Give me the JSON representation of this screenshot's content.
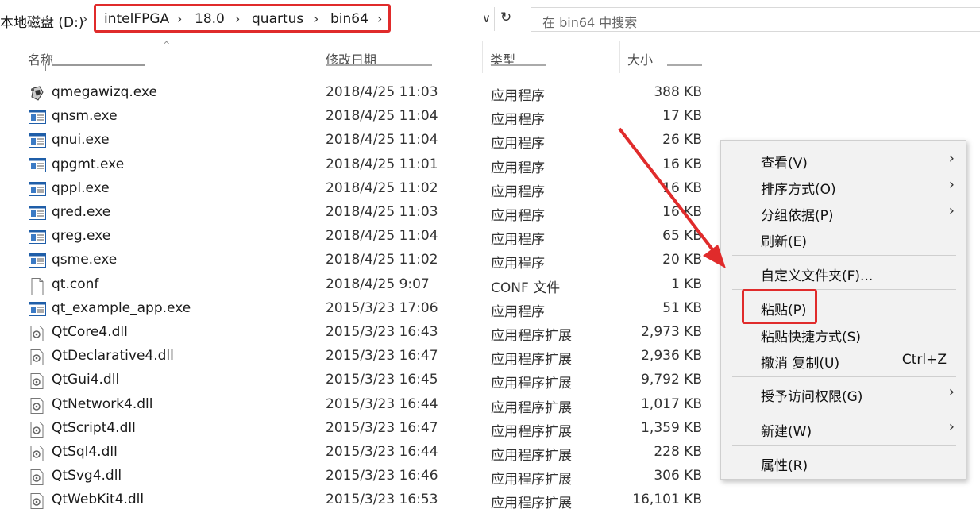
{
  "address": {
    "root": "本地磁盘 (D:)",
    "path": [
      "intelFPGA",
      "18.0",
      "quartus",
      "bin64"
    ],
    "sep": "›",
    "dropdown": "∨",
    "refresh": "↻"
  },
  "search": {
    "placeholder": "在 bin64 中搜索"
  },
  "columns": {
    "name": "名称",
    "date": "修改日期",
    "type": "类型",
    "size": "大小"
  },
  "files": [
    {
      "name": "qmegawizq.exe",
      "date": "2018/4/25 11:03",
      "type": "应用程序",
      "size": "388 KB",
      "icon": "app-wizard-icon"
    },
    {
      "name": "qnsm.exe",
      "date": "2018/4/25 11:04",
      "type": "应用程序",
      "size": "17 KB",
      "icon": "exe-window-icon"
    },
    {
      "name": "qnui.exe",
      "date": "2018/4/25 11:04",
      "type": "应用程序",
      "size": "26 KB",
      "icon": "exe-window-icon"
    },
    {
      "name": "qpgmt.exe",
      "date": "2018/4/25 11:01",
      "type": "应用程序",
      "size": "16 KB",
      "icon": "exe-window-icon"
    },
    {
      "name": "qppl.exe",
      "date": "2018/4/25 11:02",
      "type": "应用程序",
      "size": "16 KB",
      "icon": "exe-window-icon"
    },
    {
      "name": "qred.exe",
      "date": "2018/4/25 11:03",
      "type": "应用程序",
      "size": "16 KB",
      "icon": "exe-window-icon"
    },
    {
      "name": "qreg.exe",
      "date": "2018/4/25 11:04",
      "type": "应用程序",
      "size": "65 KB",
      "icon": "exe-window-icon"
    },
    {
      "name": "qsme.exe",
      "date": "2018/4/25 11:02",
      "type": "应用程序",
      "size": "20 KB",
      "icon": "exe-window-icon"
    },
    {
      "name": "qt.conf",
      "date": "2018/4/25 9:07",
      "type": "CONF 文件",
      "size": "1 KB",
      "icon": "blank-file-icon"
    },
    {
      "name": "qt_example_app.exe",
      "date": "2015/3/23 17:06",
      "type": "应用程序",
      "size": "51 KB",
      "icon": "exe-window-icon"
    },
    {
      "name": "QtCore4.dll",
      "date": "2015/3/23 16:43",
      "type": "应用程序扩展",
      "size": "2,973 KB",
      "icon": "dll-gear-icon"
    },
    {
      "name": "QtDeclarative4.dll",
      "date": "2015/3/23 16:47",
      "type": "应用程序扩展",
      "size": "2,936 KB",
      "icon": "dll-gear-icon"
    },
    {
      "name": "QtGui4.dll",
      "date": "2015/3/23 16:45",
      "type": "应用程序扩展",
      "size": "9,792 KB",
      "icon": "dll-gear-icon"
    },
    {
      "name": "QtNetwork4.dll",
      "date": "2015/3/23 16:44",
      "type": "应用程序扩展",
      "size": "1,017 KB",
      "icon": "dll-gear-icon"
    },
    {
      "name": "QtScript4.dll",
      "date": "2015/3/23 16:47",
      "type": "应用程序扩展",
      "size": "1,359 KB",
      "icon": "dll-gear-icon"
    },
    {
      "name": "QtSql4.dll",
      "date": "2015/3/23 16:44",
      "type": "应用程序扩展",
      "size": "228 KB",
      "icon": "dll-gear-icon"
    },
    {
      "name": "QtSvg4.dll",
      "date": "2015/3/23 16:46",
      "type": "应用程序扩展",
      "size": "306 KB",
      "icon": "dll-gear-icon"
    },
    {
      "name": "QtWebKit4.dll",
      "date": "2015/3/23 16:53",
      "type": "应用程序扩展",
      "size": "16,101 KB",
      "icon": "dll-gear-icon"
    }
  ],
  "context_menu": {
    "items": [
      {
        "label": "查看(V)",
        "arrow": true
      },
      {
        "label": "排序方式(O)",
        "arrow": true
      },
      {
        "label": "分组依据(P)",
        "arrow": true
      },
      {
        "label": "刷新(E)"
      },
      {
        "label": "自定义文件夹(F)..."
      },
      {
        "label": "粘贴(P)",
        "highlighted": true
      },
      {
        "label": "粘贴快捷方式(S)"
      },
      {
        "label": "撤消 复制(U)",
        "shortcut": "Ctrl+Z"
      },
      {
        "label": "授予访问权限(G)",
        "arrow": true
      },
      {
        "label": "新建(W)",
        "arrow": true
      },
      {
        "label": "属性(R)"
      }
    ],
    "arrow_glyph": "›"
  },
  "annotation": {
    "color": "#e02b2b"
  }
}
